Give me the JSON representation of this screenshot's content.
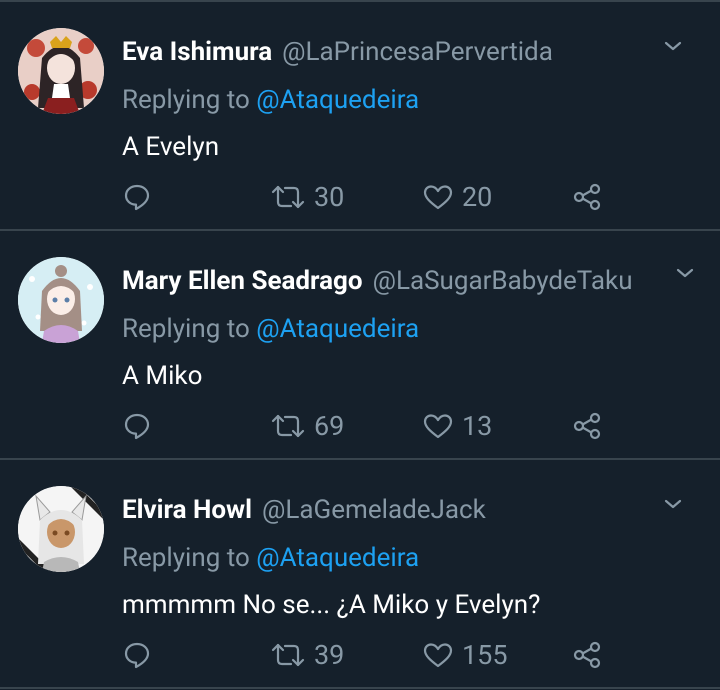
{
  "tweets": [
    {
      "display_name": "Eva Ishimura",
      "handle": "@LaPrincesaPervertida",
      "reply_prefix": "Replying to",
      "reply_to": "@Ataquedeira",
      "text": "A Evelyn",
      "retweets": "30",
      "likes": "20",
      "avatar_color": "#d0a9a0"
    },
    {
      "display_name": "Mary Ellen Seadrago",
      "handle": "@LaSugarBabydeTaku",
      "reply_prefix": "Replying to",
      "reply_to": "@Ataquedeira",
      "text": "A Miko",
      "retweets": "69",
      "likes": "13",
      "avatar_color": "#bfe3ee"
    },
    {
      "display_name": "Elvira Howl",
      "handle": "@LaGemeladeJack",
      "reply_prefix": "Replying to",
      "reply_to": "@Ataquedeira",
      "text": "mmmmm No se... ¿A Miko y Evelyn?",
      "retweets": "39",
      "likes": "155",
      "avatar_color": "#f2f2f2"
    }
  ],
  "colors": {
    "background": "#15202b",
    "divider": "#38444d",
    "secondary_text": "#8899a6",
    "link": "#1da1f2"
  },
  "icons": [
    "reply-icon",
    "retweet-icon",
    "like-icon",
    "share-icon",
    "chevron-down-icon"
  ]
}
